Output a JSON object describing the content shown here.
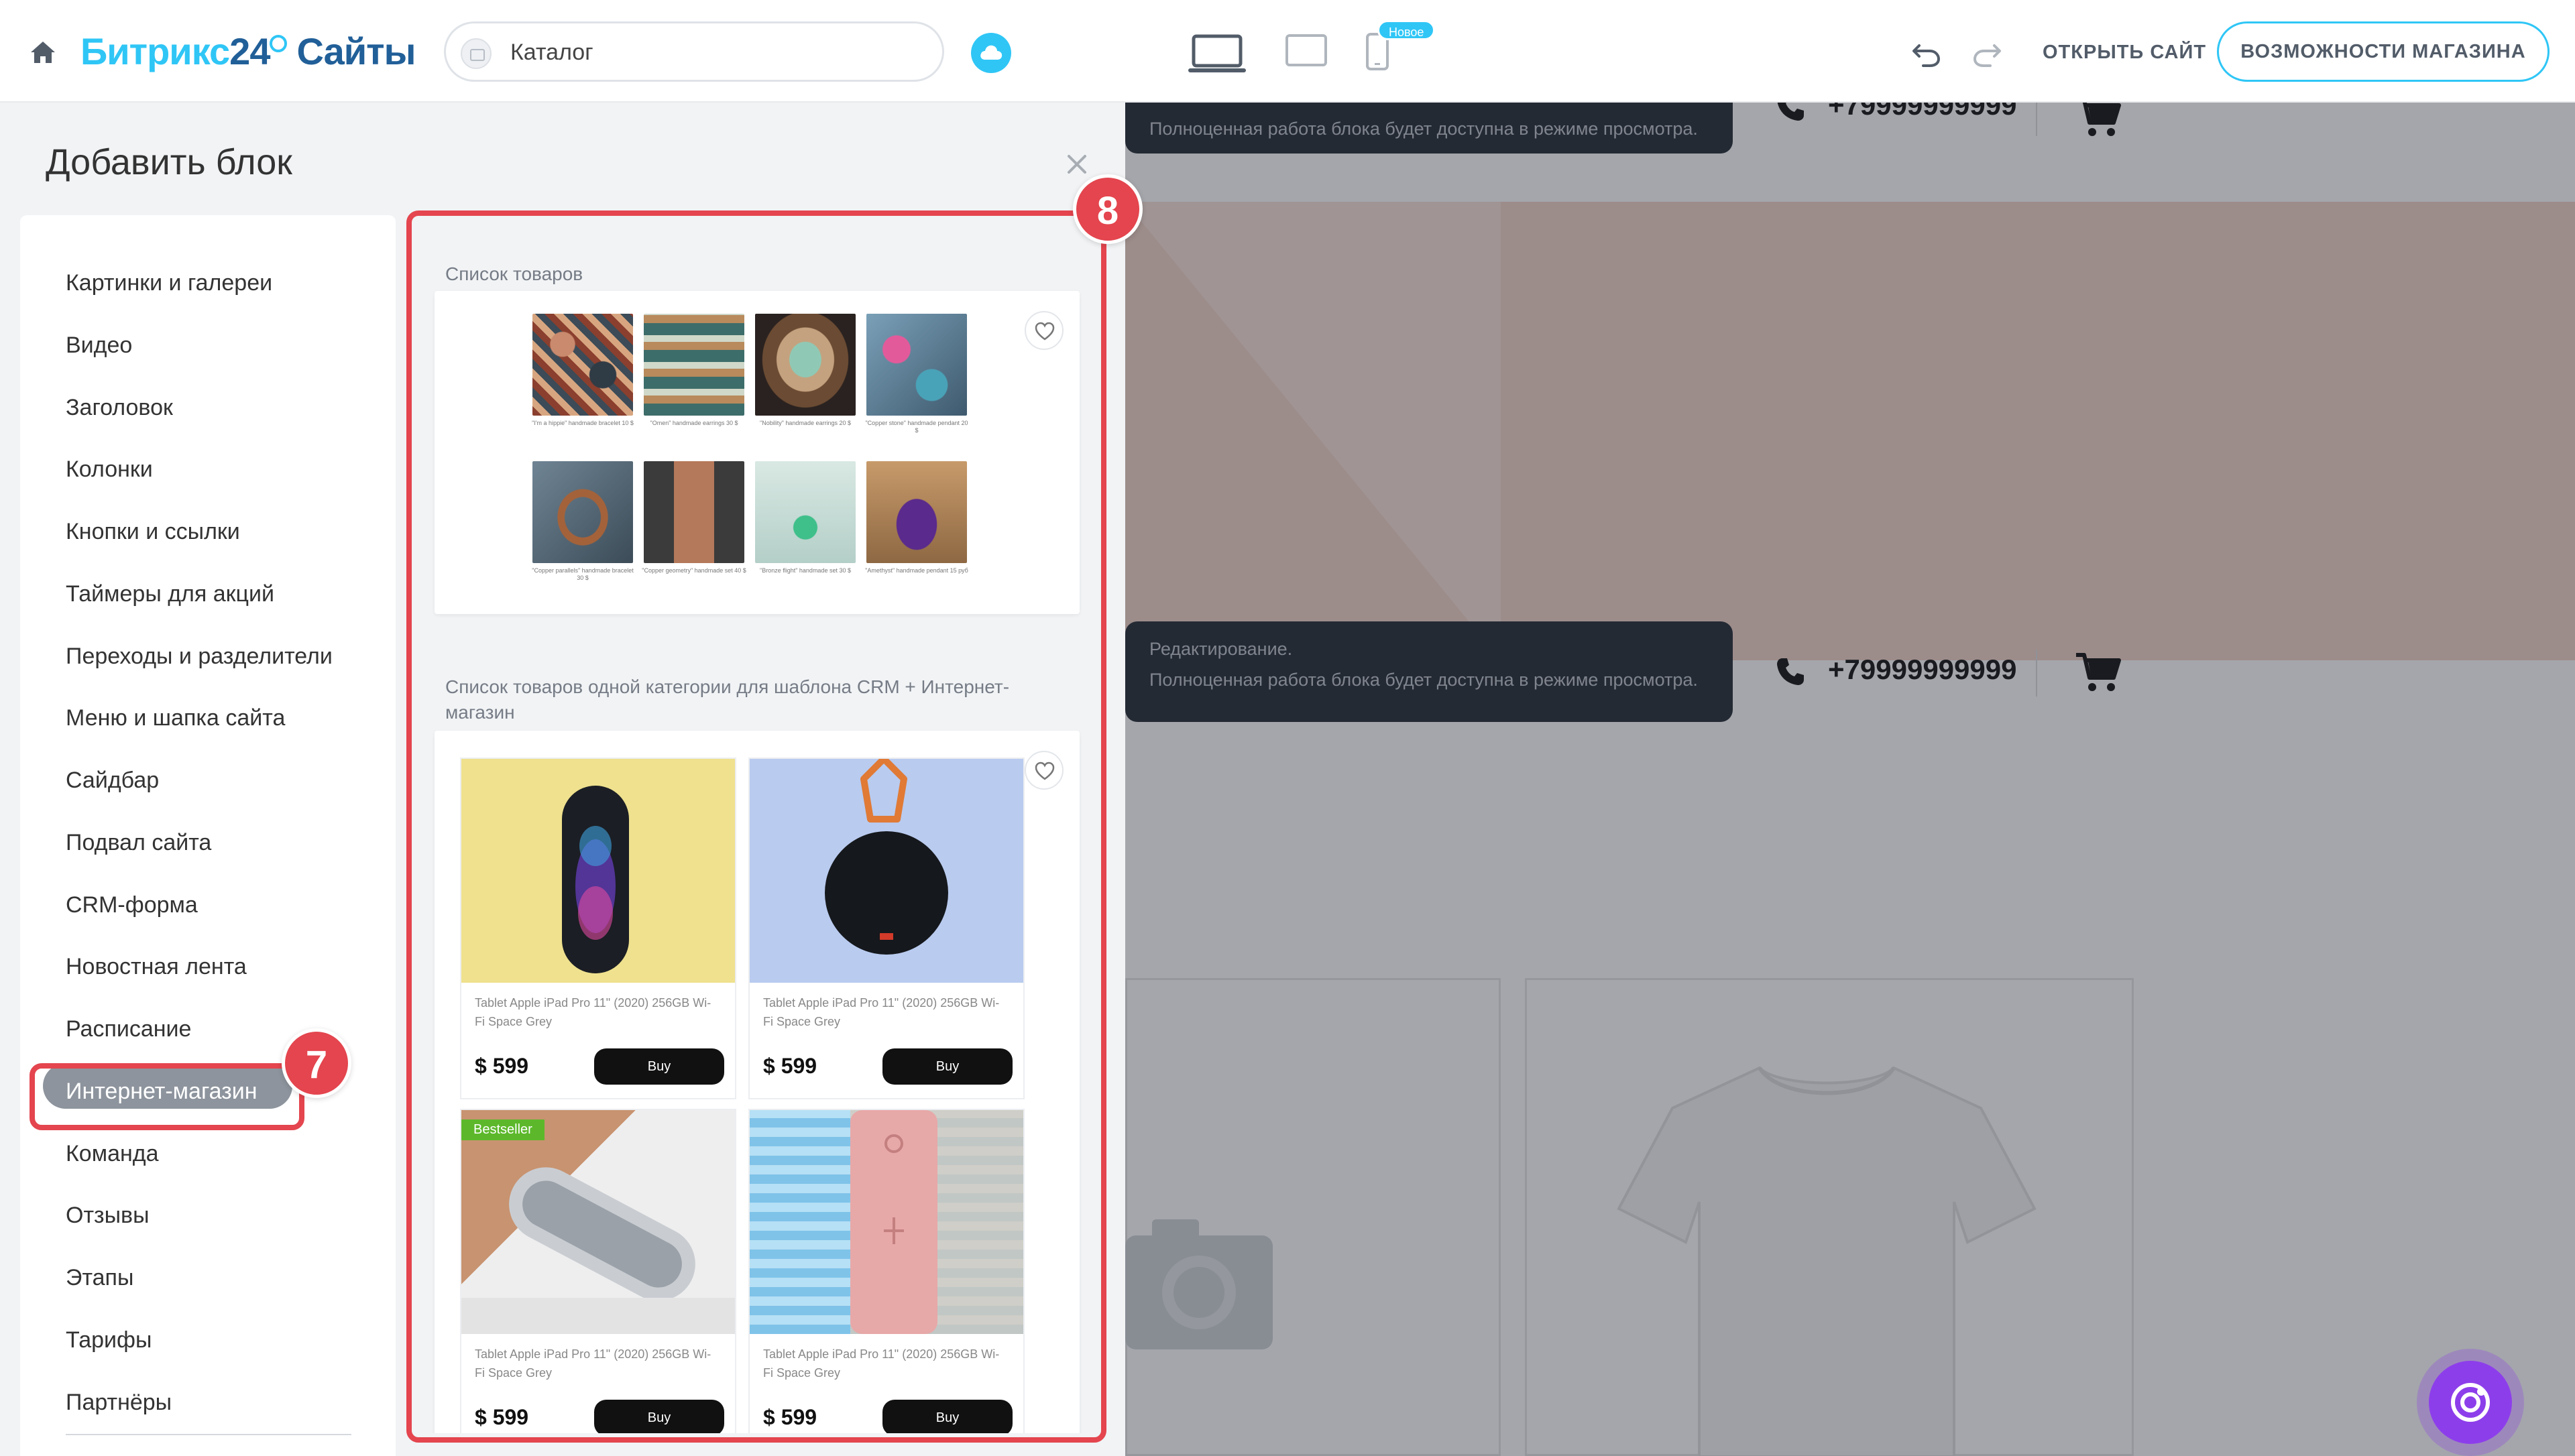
{
  "topbar": {
    "logo_part1": "Битрикс",
    "logo_part2": "24",
    "logo_part3": "Сайты",
    "page_selector": "Каталог",
    "new_badge": "Новое",
    "open_site": "ОТКРЫТЬ САЙТ",
    "shop_features": "ВОЗМОЖНОСТИ МАГАЗИНА"
  },
  "panel": {
    "title": "Добавить блок",
    "categories": [
      "Картинки и галереи",
      "Видео",
      "Заголовок",
      "Колонки",
      "Кнопки и ссылки",
      "Таймеры для акций",
      "Переходы и разделители",
      "Меню и шапка сайта",
      "Сайдбар",
      "Подвал сайта",
      "CRM-форма",
      "Новостная лента",
      "Расписание",
      "Интернет-магазин",
      "Команда",
      "Отзывы",
      "Этапы",
      "Тарифы",
      "Партнёры"
    ],
    "active_category": "Интернет-магазин"
  },
  "annotations": {
    "badge7": "7",
    "badge8": "8"
  },
  "templates": [
    {
      "label": "Список товаров",
      "thumb_captions": [
        "\"I'm a hippie\" handmade bracelet 10 $",
        "\"Omen\" handmade earrings 30 $",
        "\"Nobility\" handmade earrings 20 $",
        "\"Copper stone\" handmade pendant 20 $",
        "\"Copper parallels\" handmade bracelet 30 $",
        "\"Copper geometry\" handmade set 40 $",
        "\"Bronze flight\" handmade set 30 $",
        "\"Amethyst\" handmade pendant 15 руб"
      ]
    },
    {
      "label": "Список товаров одной категории для шаблона CRM + Интернет-магазин",
      "products": [
        {
          "name": "Tablet Apple iPad Pro 11\" (2020) 256GB Wi-Fi Space Grey",
          "price": "$ 599",
          "buy": "Buy",
          "badge": ""
        },
        {
          "name": "Tablet Apple iPad Pro 11\" (2020) 256GB Wi-Fi Space Grey",
          "price": "$ 599",
          "buy": "Buy",
          "badge": ""
        },
        {
          "name": "Tablet Apple iPad Pro 11\" (2020) 256GB Wi-Fi Space Grey",
          "price": "$ 599",
          "buy": "Buy",
          "badge": "Bestseller"
        },
        {
          "name": "Tablet Apple iPad Pro 11\" (2020) 256GB Wi-Fi Space Grey",
          "price": "$ 599",
          "buy": "Buy",
          "badge": ""
        }
      ]
    }
  ],
  "preview": {
    "tip_title": "Редактирование.",
    "tip_text": "Полноценная работа блока будет доступна в режиме просмотра.",
    "phone": "+79999999999"
  },
  "colors": {
    "accent": "#2fc6f6",
    "brand_dark": "#215f98",
    "highlight": "#e4454e",
    "ai": "#8d3eeb"
  }
}
